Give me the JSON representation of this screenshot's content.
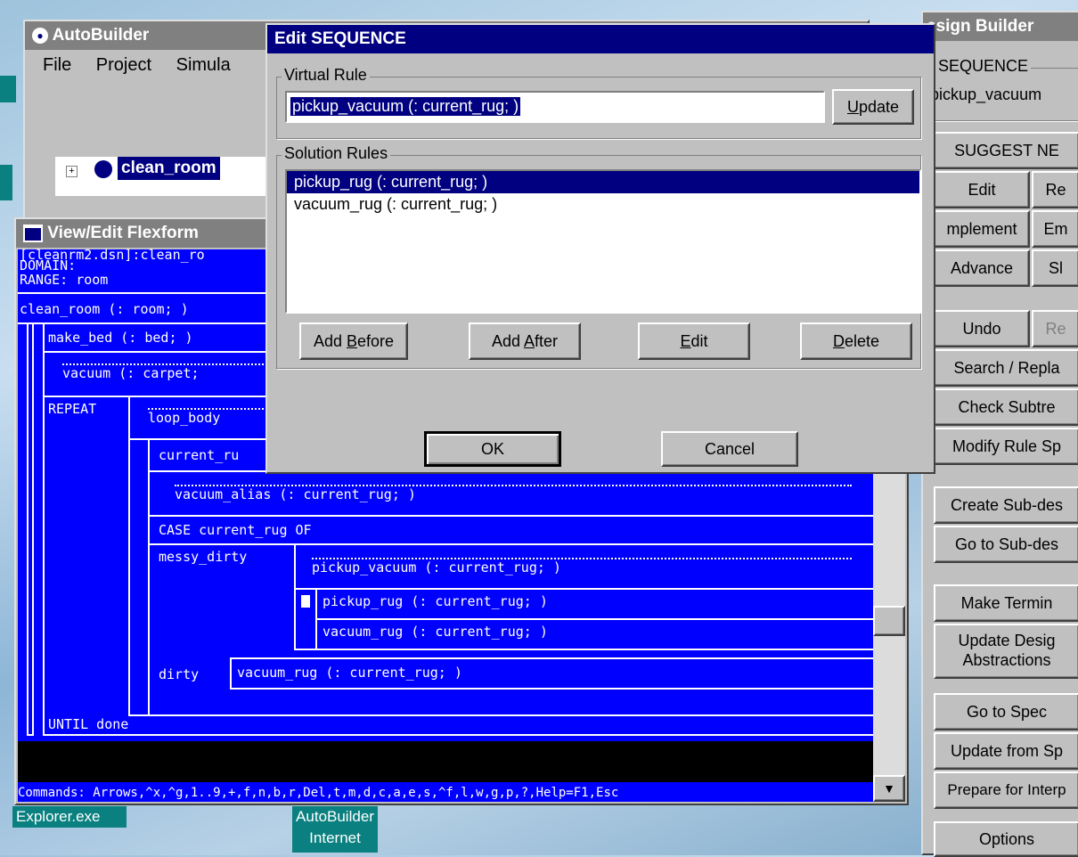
{
  "taskbar": {
    "explorer": "Explorer.exe",
    "autobuilder_line1": "AutoBuilder",
    "autobuilder_line2": "Internet"
  },
  "autobuilder": {
    "title": "AutoBuilder",
    "menu": [
      "File",
      "Project",
      "Simula"
    ],
    "tree_item": "clean_room"
  },
  "flexform": {
    "title": "View/Edit Flexform",
    "header": [
      "[cleanrm2.dsn]:clean_ro",
      "DOMAIN:",
      "RANGE: room"
    ],
    "root": "clean_room (: room; )",
    "make_bed": "make_bed (: bed; )",
    "vacuum_carpet": "vacuum (: carpet;",
    "repeat": "REPEAT",
    "loop_body": "loop_body",
    "current_ru": "current_ru",
    "vacuum_alias": "vacuum_alias (: current_rug; )",
    "case": "CASE current_rug OF",
    "messy_dirty": "messy_dirty",
    "pickup_vacuum": "pickup_vacuum (: current_rug; )",
    "pickup_rug": "pickup_rug (: current_rug; )",
    "vacuum_rug": "vacuum_rug (: current_rug; )",
    "dirty": "dirty",
    "dirty_vacuum_rug": "vacuum_rug (: current_rug; )",
    "until": "UNTIL done",
    "commands": "Commands: Arrows,^x,^g,1..9,+,f,n,b,r,Del,t,m,d,c,a,e,s,^f,l,w,g,p,?,Help=F1,Esc"
  },
  "dialog": {
    "title": "Edit SEQUENCE",
    "virtual_rule_label": "Virtual Rule",
    "virtual_rule_value": "pickup_vacuum (: current_rug; )",
    "update": "Update",
    "solution_rules_label": "Solution Rules",
    "rules": [
      "pickup_rug (: current_rug; )",
      "vacuum_rug (: current_rug; )"
    ],
    "add_before": "Add Before",
    "add_after": "Add After",
    "edit": "Edit",
    "delete": "Delete",
    "ok": "OK",
    "cancel": "Cancel"
  },
  "design_builder": {
    "title": "esign Builder",
    "group_label": "SEQUENCE",
    "sequence_value": "pickup_vacuum",
    "suggest": "SUGGEST NE",
    "edit": "Edit",
    "re": "Re",
    "implement": "mplement",
    "em": "Em",
    "advance": "Advance",
    "sl": "Sl",
    "undo": "Undo",
    "redo": "Re",
    "search_replace": "Search / Repla",
    "check_subtree": "Check Subtre",
    "modify_rule": "Modify Rule Sp",
    "create_sub": "Create Sub-des",
    "goto_sub": "Go to Sub-des",
    "make_terminal": "Make Termin",
    "update_design_1": "Update Desig",
    "update_design_2": "Abstractions",
    "goto_spec": "Go to Spec",
    "update_from_spec": "Update from Sp",
    "prepare_interp": "Prepare for Interp",
    "options": "Options"
  }
}
